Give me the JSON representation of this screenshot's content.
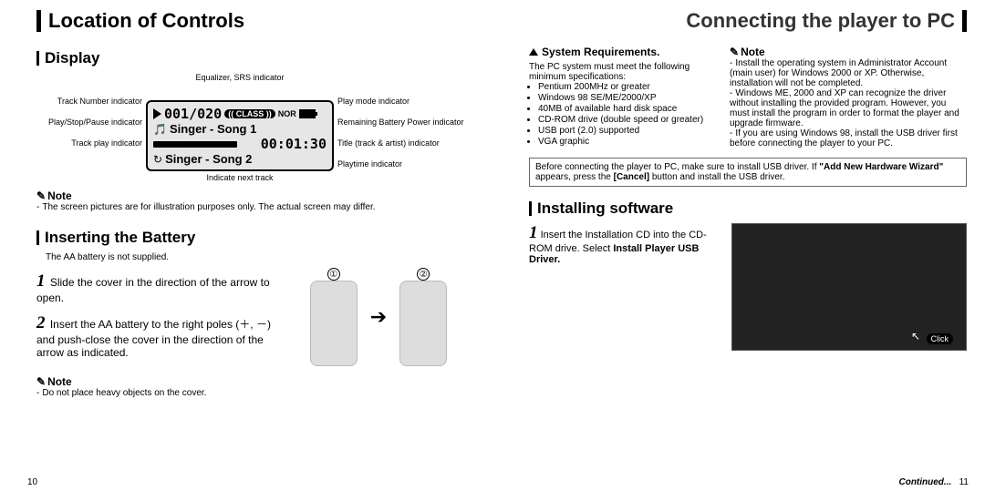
{
  "header_left": "Location of Controls",
  "header_right": "Connecting the player to PC",
  "left": {
    "display": {
      "title": "Display",
      "eq_label": "Equalizer, SRS indicator",
      "callouts_left": [
        "Track Number indicator",
        "Play/Stop/Pause indicator",
        "Track play indicator"
      ],
      "callouts_right": [
        "Play mode indicator",
        "Remaining Battery Power indicator",
        "Title (track & artist) indicator",
        "Playtime indicator"
      ],
      "lcd": {
        "counter": "001/020",
        "class_badge": "(( CLASS ))",
        "nor": "NOR",
        "song1": "Singer - Song 1",
        "time": "00:01:30",
        "song2": "Singer - Song 2"
      },
      "under_lcd": "Indicate next track",
      "note_title": "Note",
      "note_text": "The screen pictures are for illustration purposes only. The actual screen may differ."
    },
    "battery": {
      "title": "Inserting the Battery",
      "preface": "The AA battery is not supplied.",
      "steps": [
        "Slide the cover in the direction of the arrow to open.",
        "Insert the AA battery to the right poles (＋, －) and push-close the cover in the direction of the arrow as indicated."
      ],
      "fig_labels": [
        "①",
        "②"
      ],
      "note_title": "Note",
      "note_text": "Do not place heavy objects on the cover."
    }
  },
  "right": {
    "sysreq": {
      "title": "System Requirements.",
      "intro": "The PC system must meet the following minimum specifications:",
      "items": [
        "Pentium 200MHz or greater",
        "Windows 98 SE/ME/2000/XP",
        "40MB of available hard disk space",
        "CD-ROM drive (double speed or greater)",
        "USB port (2.0) supported",
        "VGA graphic"
      ],
      "note_title": "Note",
      "note_items": [
        "Install the operating system in Administrator Account (main user) for Windows 2000 or XP. Otherwise, installation will not be completed.",
        "Windows ME, 2000 and XP can recognize the driver without installing the provided program. However, you must install the program in order to format the player and upgrade firmware.",
        "If you are using Windows 98, install the USB driver first before connecting the player to your PC."
      ]
    },
    "boxnote_pre": "Before connecting the player to PC, make sure to install USB driver. If ",
    "boxnote_bold1": "\"Add New Hardware Wizard\"",
    "boxnote_mid": " appears, press the ",
    "boxnote_cancel": "[Cancel]",
    "boxnote_post": " button and install the USB driver.",
    "install": {
      "title": "Installing software",
      "step1_pre": "Insert the Installation CD into the CD-ROM drive. Select ",
      "step1_bold": "Install Player USB Driver.",
      "click_label": "Click"
    }
  },
  "footer": {
    "page_left": "10",
    "continued": "Continued...",
    "page_right": "11"
  }
}
